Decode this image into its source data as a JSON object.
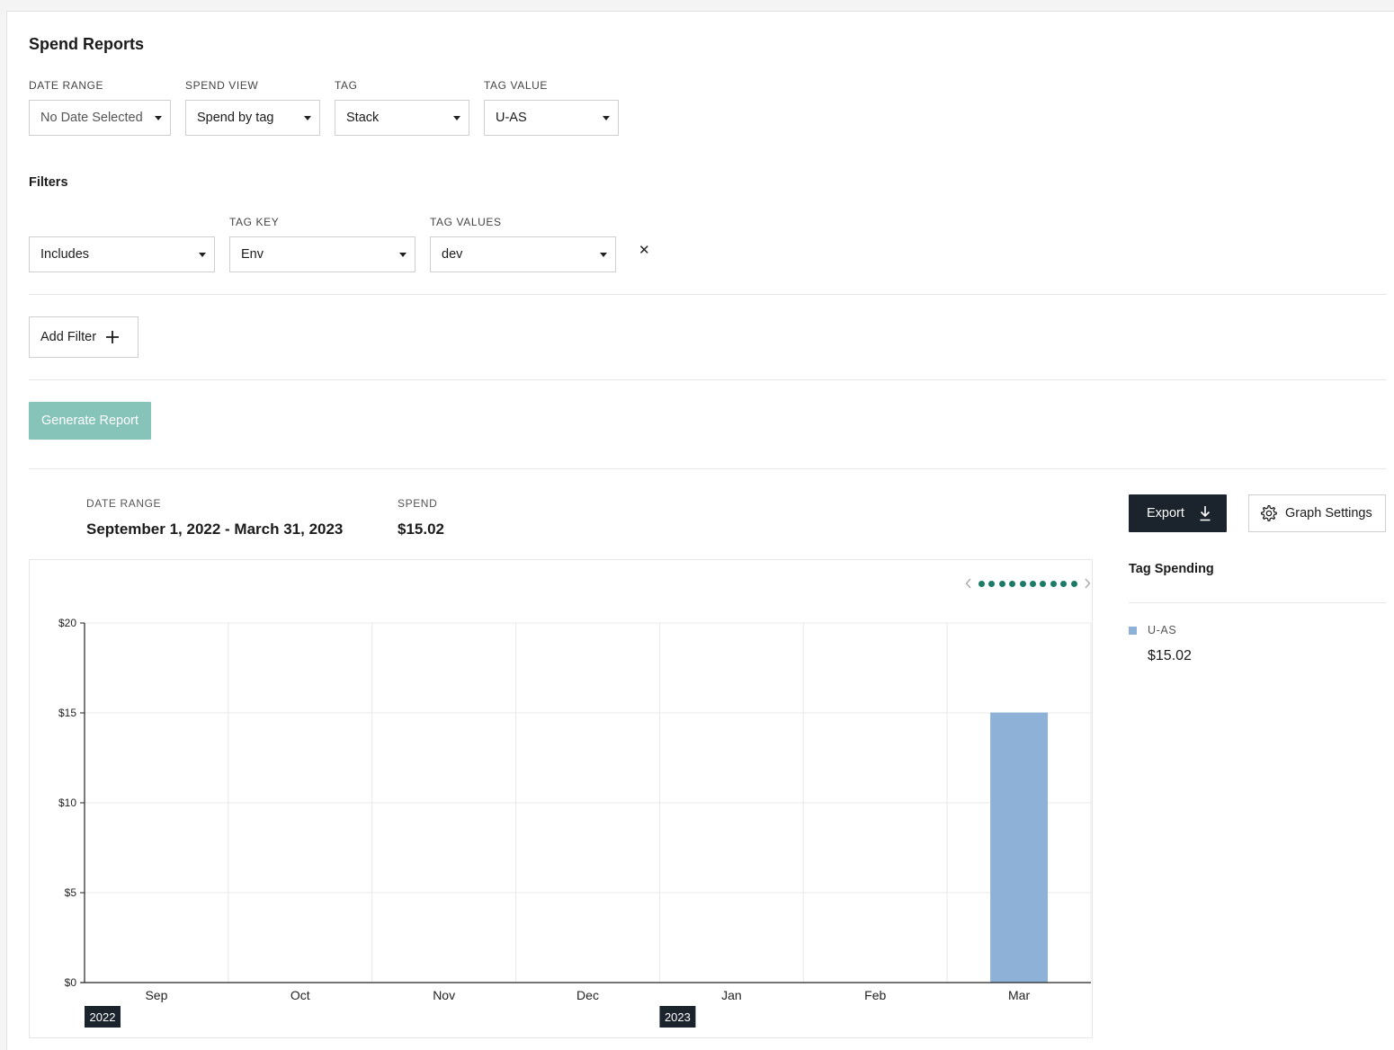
{
  "page_title": "Spend Reports",
  "controls": {
    "date_range": {
      "label": "DATE RANGE",
      "value": "No Date Selected"
    },
    "spend_view": {
      "label": "SPEND VIEW",
      "value": "Spend by tag"
    },
    "tag": {
      "label": "TAG",
      "value": "Stack"
    },
    "tag_value": {
      "label": "TAG VALUE",
      "value": "U-AS"
    }
  },
  "filters": {
    "title": "Filters",
    "rows": [
      {
        "operator": "Includes",
        "tag_key_label": "TAG KEY",
        "tag_key": "Env",
        "tag_values_label": "TAG VALUES",
        "tag_values": "dev"
      }
    ],
    "remove_glyph": "✕",
    "add_filter_label": "Add Filter"
  },
  "generate_label": "Generate Report",
  "summary": {
    "date_range_label": "DATE RANGE",
    "date_range_value": "September 1, 2022 - March 31, 2023",
    "spend_label": "SPEND",
    "spend_value": "$15.02"
  },
  "export_label": "Export",
  "graph_settings_label": "Graph Settings",
  "tag_spending": {
    "title": "Tag Spending",
    "items": [
      {
        "name": "U-AS",
        "amount": "$15.02",
        "color": "#8db1d7"
      }
    ]
  },
  "pager": {
    "dot_count": 10
  },
  "colors": {
    "accent": "#1a7a66",
    "bar": "#8db1d7",
    "dark": "#1b242c",
    "generate": "#86c3b9"
  },
  "icons": {
    "caret": "caret-down-icon",
    "remove": "close-icon",
    "add": "plus-icon",
    "export": "download-icon",
    "settings": "gear-icon",
    "prev": "chevron-left-icon",
    "next": "chevron-right-icon"
  },
  "chart_data": {
    "type": "bar",
    "categories": [
      "Sep",
      "Oct",
      "Nov",
      "Dec",
      "Jan",
      "Feb",
      "Mar"
    ],
    "year_markers": [
      {
        "label": "2022",
        "category": "Sep"
      },
      {
        "label": "2023",
        "category": "Jan"
      }
    ],
    "series": [
      {
        "name": "U-AS",
        "values": [
          0,
          0,
          0,
          0,
          0,
          0,
          15.02
        ]
      }
    ],
    "ylim": [
      0,
      20
    ],
    "yticks": [
      0,
      5,
      10,
      15,
      20
    ],
    "ytick_labels": [
      "$0",
      "$5",
      "$10",
      "$15",
      "$20"
    ],
    "grid": true,
    "xlabel": "",
    "ylabel": "",
    "title": ""
  }
}
